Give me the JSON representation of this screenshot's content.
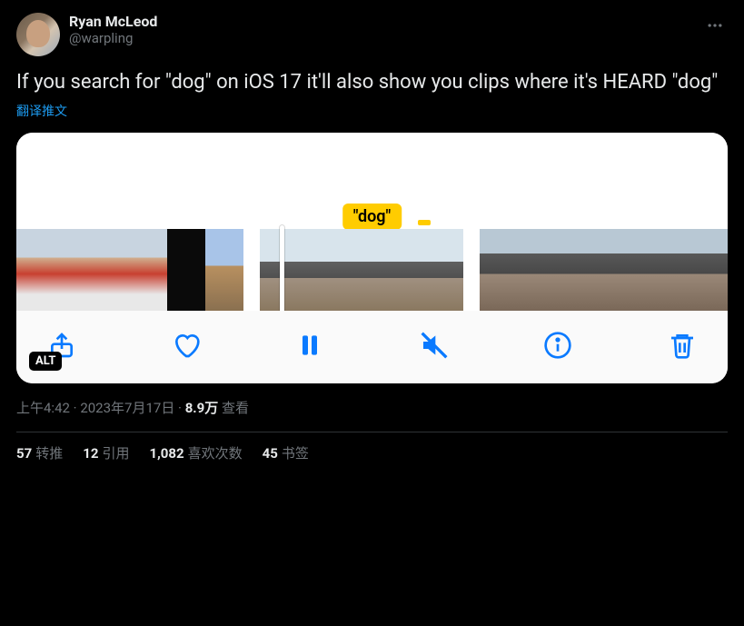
{
  "user": {
    "display_name": "Ryan McLeod",
    "handle": "@warpling"
  },
  "tweet_text": "If you search for \"dog\" on iOS 17 it'll also show you clips where it's HEARD \"dog\"",
  "translate_label": "翻译推文",
  "media": {
    "caption_tag": "\"dog\"",
    "alt_badge": "ALT"
  },
  "meta": {
    "time": "上午4:42",
    "date": "2023年7月17日",
    "views_count": "8.9万",
    "views_label": "查看",
    "dot": " · "
  },
  "stats": {
    "retweets": {
      "count": "57",
      "label": "转推"
    },
    "quotes": {
      "count": "12",
      "label": "引用"
    },
    "likes": {
      "count": "1,082",
      "label": "喜欢次数"
    },
    "bookmarks": {
      "count": "45",
      "label": "书签"
    }
  }
}
